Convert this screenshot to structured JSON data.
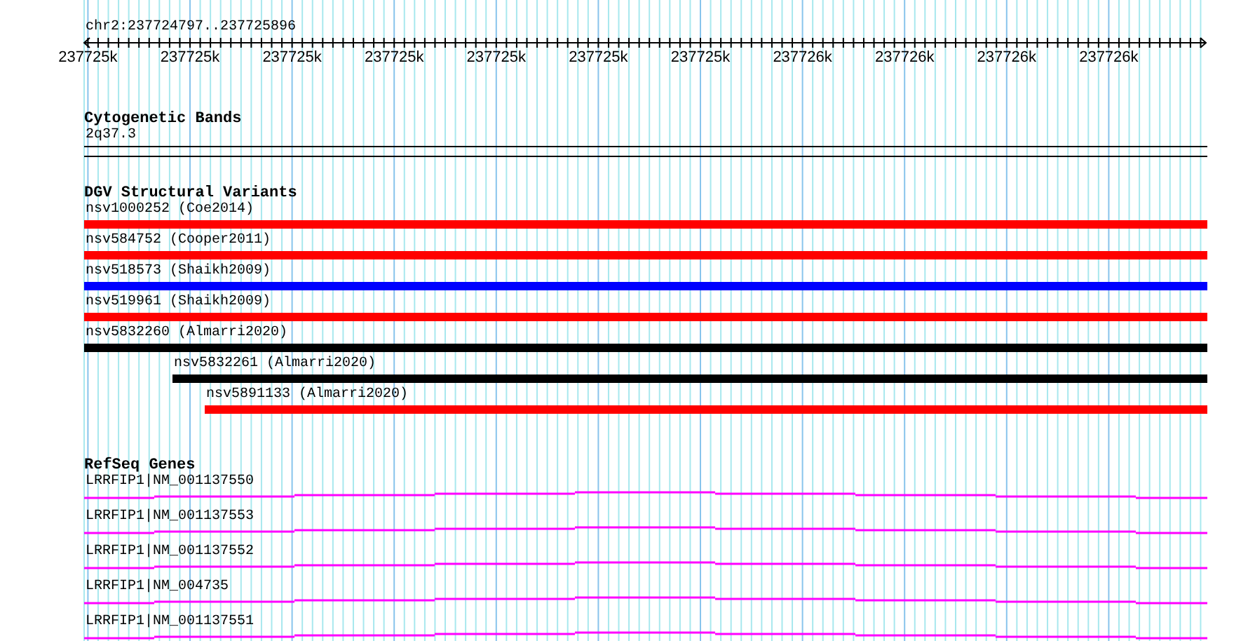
{
  "ruler": {
    "location": "chr2:237724797..237725896",
    "tick_labels": [
      "237725k",
      "237725k",
      "237725k",
      "237725k",
      "237725k",
      "237725k",
      "237725k",
      "237726k",
      "237726k",
      "237726k",
      "237726k"
    ]
  },
  "tracks": [
    {
      "kind": "bands",
      "title": "Cytogenetic Bands",
      "items": [
        {
          "label": "2q37.3"
        }
      ]
    },
    {
      "kind": "variants",
      "title": "DGV Structural Variants",
      "items": [
        {
          "label": "nsv1000252 (Coe2014)",
          "color": "#ff0000"
        },
        {
          "label": "nsv584752 (Cooper2011)",
          "color": "#ff0000"
        },
        {
          "label": "nsv518573 (Shaikh2009)",
          "color": "#0000ff"
        },
        {
          "label": "nsv519961 (Shaikh2009)",
          "color": "#ff0000"
        },
        {
          "label": "nsv5832260 (Almarri2020)",
          "color": "#000000"
        },
        {
          "label": "nsv5832261 (Almarri2020)",
          "color": "#000000"
        },
        {
          "label": "nsv5891133 (Almarri2020)",
          "color": "#ff0000"
        }
      ]
    },
    {
      "kind": "genes",
      "title": "RefSeq Genes",
      "items": [
        {
          "label": "LRRFIP1|NM_001137550"
        },
        {
          "label": "LRRFIP1|NM_001137553"
        },
        {
          "label": "LRRFIP1|NM_001137552"
        },
        {
          "label": "LRRFIP1|NM_004735"
        },
        {
          "label": "LRRFIP1|NM_001137551"
        }
      ]
    }
  ]
}
